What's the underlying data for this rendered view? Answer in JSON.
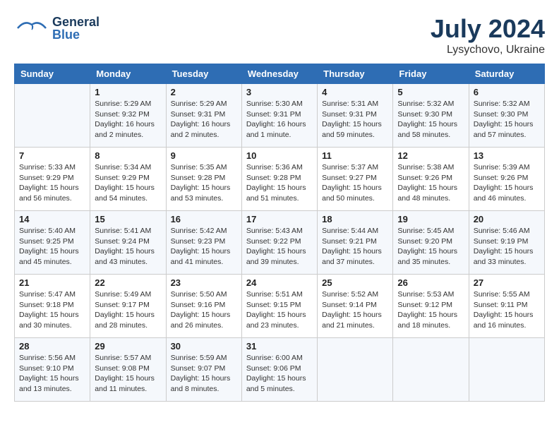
{
  "header": {
    "logo_general": "General",
    "logo_blue": "Blue",
    "month_year": "July 2024",
    "location": "Lysychovo, Ukraine"
  },
  "calendar": {
    "weekdays": [
      "Sunday",
      "Monday",
      "Tuesday",
      "Wednesday",
      "Thursday",
      "Friday",
      "Saturday"
    ],
    "weeks": [
      [
        {
          "day": "",
          "info": ""
        },
        {
          "day": "1",
          "info": "Sunrise: 5:29 AM\nSunset: 9:32 PM\nDaylight: 16 hours\nand 2 minutes."
        },
        {
          "day": "2",
          "info": "Sunrise: 5:29 AM\nSunset: 9:31 PM\nDaylight: 16 hours\nand 2 minutes."
        },
        {
          "day": "3",
          "info": "Sunrise: 5:30 AM\nSunset: 9:31 PM\nDaylight: 16 hours\nand 1 minute."
        },
        {
          "day": "4",
          "info": "Sunrise: 5:31 AM\nSunset: 9:31 PM\nDaylight: 15 hours\nand 59 minutes."
        },
        {
          "day": "5",
          "info": "Sunrise: 5:32 AM\nSunset: 9:30 PM\nDaylight: 15 hours\nand 58 minutes."
        },
        {
          "day": "6",
          "info": "Sunrise: 5:32 AM\nSunset: 9:30 PM\nDaylight: 15 hours\nand 57 minutes."
        }
      ],
      [
        {
          "day": "7",
          "info": "Sunrise: 5:33 AM\nSunset: 9:29 PM\nDaylight: 15 hours\nand 56 minutes."
        },
        {
          "day": "8",
          "info": "Sunrise: 5:34 AM\nSunset: 9:29 PM\nDaylight: 15 hours\nand 54 minutes."
        },
        {
          "day": "9",
          "info": "Sunrise: 5:35 AM\nSunset: 9:28 PM\nDaylight: 15 hours\nand 53 minutes."
        },
        {
          "day": "10",
          "info": "Sunrise: 5:36 AM\nSunset: 9:28 PM\nDaylight: 15 hours\nand 51 minutes."
        },
        {
          "day": "11",
          "info": "Sunrise: 5:37 AM\nSunset: 9:27 PM\nDaylight: 15 hours\nand 50 minutes."
        },
        {
          "day": "12",
          "info": "Sunrise: 5:38 AM\nSunset: 9:26 PM\nDaylight: 15 hours\nand 48 minutes."
        },
        {
          "day": "13",
          "info": "Sunrise: 5:39 AM\nSunset: 9:26 PM\nDaylight: 15 hours\nand 46 minutes."
        }
      ],
      [
        {
          "day": "14",
          "info": "Sunrise: 5:40 AM\nSunset: 9:25 PM\nDaylight: 15 hours\nand 45 minutes."
        },
        {
          "day": "15",
          "info": "Sunrise: 5:41 AM\nSunset: 9:24 PM\nDaylight: 15 hours\nand 43 minutes."
        },
        {
          "day": "16",
          "info": "Sunrise: 5:42 AM\nSunset: 9:23 PM\nDaylight: 15 hours\nand 41 minutes."
        },
        {
          "day": "17",
          "info": "Sunrise: 5:43 AM\nSunset: 9:22 PM\nDaylight: 15 hours\nand 39 minutes."
        },
        {
          "day": "18",
          "info": "Sunrise: 5:44 AM\nSunset: 9:21 PM\nDaylight: 15 hours\nand 37 minutes."
        },
        {
          "day": "19",
          "info": "Sunrise: 5:45 AM\nSunset: 9:20 PM\nDaylight: 15 hours\nand 35 minutes."
        },
        {
          "day": "20",
          "info": "Sunrise: 5:46 AM\nSunset: 9:19 PM\nDaylight: 15 hours\nand 33 minutes."
        }
      ],
      [
        {
          "day": "21",
          "info": "Sunrise: 5:47 AM\nSunset: 9:18 PM\nDaylight: 15 hours\nand 30 minutes."
        },
        {
          "day": "22",
          "info": "Sunrise: 5:49 AM\nSunset: 9:17 PM\nDaylight: 15 hours\nand 28 minutes."
        },
        {
          "day": "23",
          "info": "Sunrise: 5:50 AM\nSunset: 9:16 PM\nDaylight: 15 hours\nand 26 minutes."
        },
        {
          "day": "24",
          "info": "Sunrise: 5:51 AM\nSunset: 9:15 PM\nDaylight: 15 hours\nand 23 minutes."
        },
        {
          "day": "25",
          "info": "Sunrise: 5:52 AM\nSunset: 9:14 PM\nDaylight: 15 hours\nand 21 minutes."
        },
        {
          "day": "26",
          "info": "Sunrise: 5:53 AM\nSunset: 9:12 PM\nDaylight: 15 hours\nand 18 minutes."
        },
        {
          "day": "27",
          "info": "Sunrise: 5:55 AM\nSunset: 9:11 PM\nDaylight: 15 hours\nand 16 minutes."
        }
      ],
      [
        {
          "day": "28",
          "info": "Sunrise: 5:56 AM\nSunset: 9:10 PM\nDaylight: 15 hours\nand 13 minutes."
        },
        {
          "day": "29",
          "info": "Sunrise: 5:57 AM\nSunset: 9:08 PM\nDaylight: 15 hours\nand 11 minutes."
        },
        {
          "day": "30",
          "info": "Sunrise: 5:59 AM\nSunset: 9:07 PM\nDaylight: 15 hours\nand 8 minutes."
        },
        {
          "day": "31",
          "info": "Sunrise: 6:00 AM\nSunset: 9:06 PM\nDaylight: 15 hours\nand 5 minutes."
        },
        {
          "day": "",
          "info": ""
        },
        {
          "day": "",
          "info": ""
        },
        {
          "day": "",
          "info": ""
        }
      ]
    ]
  }
}
